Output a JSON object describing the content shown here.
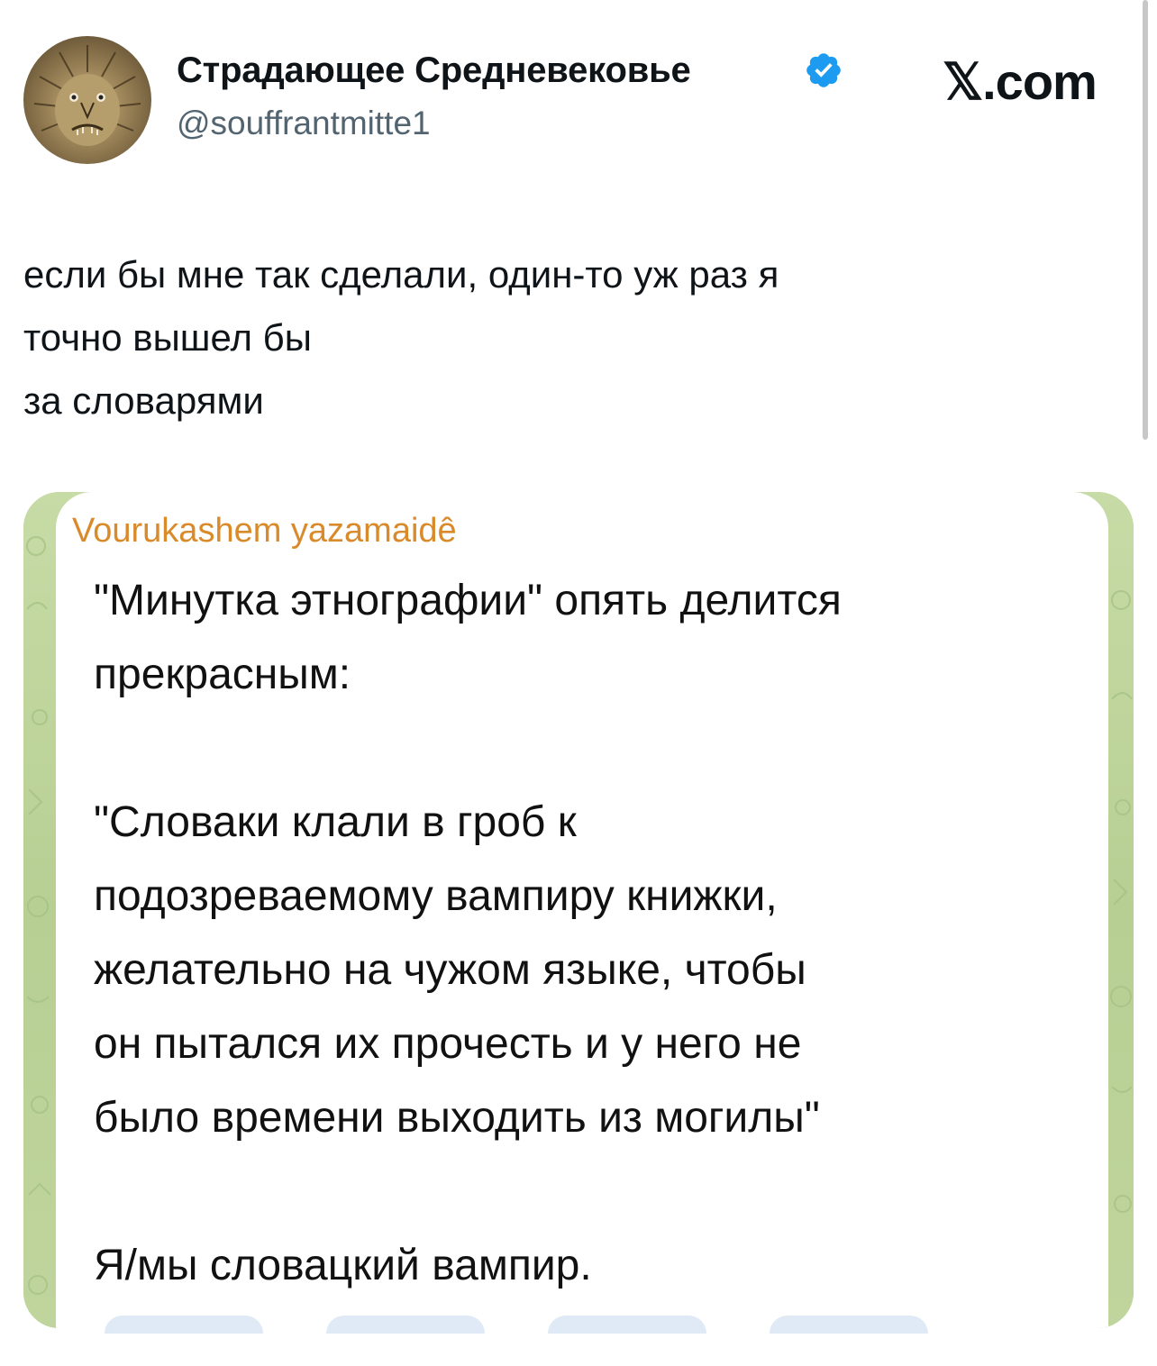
{
  "tweet": {
    "display_name": "Страдающее Средневековье",
    "handle": "@souffrantmitte1",
    "verified_icon": "verified-badge-icon",
    "brand": "𝕏.com",
    "text_lines": [
      "если бы мне так сделали, один-то уж раз я",
      "точно вышел бы",
      "за словарями"
    ]
  },
  "media": {
    "sender": "Vourukashem yazamaidê",
    "message_lines": [
      "\"Минутка этнографии\" опять делится",
      "прекрасным:",
      "",
      "\"Словаки клали в гроб к",
      "подозреваемому вампиру книжки,",
      "желательно на чужом языке, чтобы",
      "он пытался их прочесть и у него не",
      "было времени выходить из могилы\"",
      "",
      "Я/мы словацкий вампир."
    ]
  },
  "colors": {
    "verified": "#1d9bf0",
    "sender": "#d98a2b",
    "chat_background": "#b9cf9a",
    "handle": "#536471"
  }
}
